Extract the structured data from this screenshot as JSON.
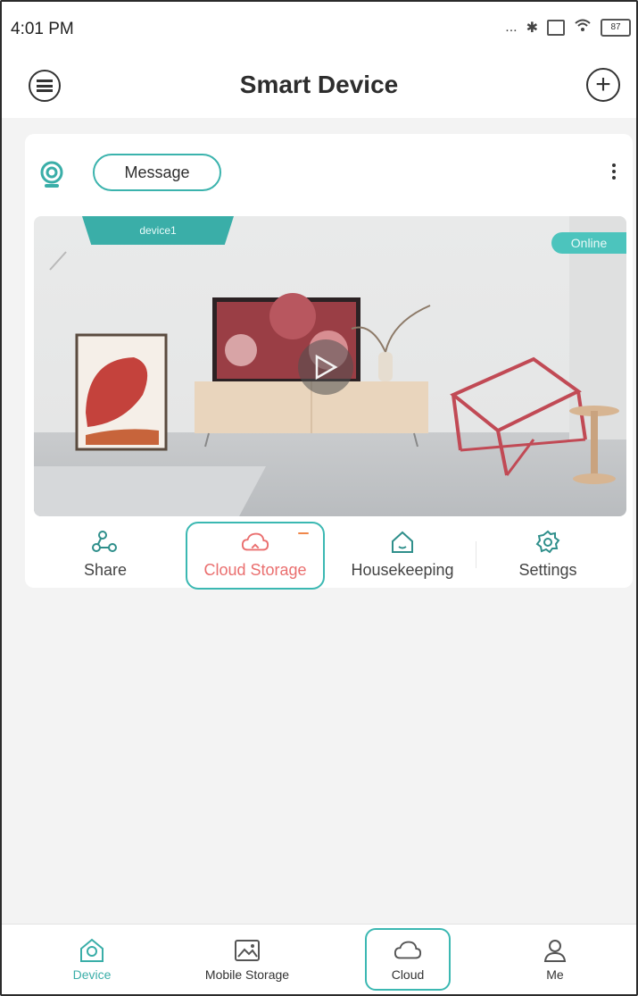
{
  "status_bar": {
    "time": "4:01 PM",
    "signal_dots": "...",
    "battery_level": "87"
  },
  "header": {
    "title": "Smart Device"
  },
  "device_card": {
    "message_label": "Message",
    "device_name": "device1",
    "status_badge": "Online",
    "actions": [
      {
        "label": "Share"
      },
      {
        "label": "Cloud Storage",
        "badge": ""
      },
      {
        "label": "Housekeeping"
      },
      {
        "label": "Settings"
      }
    ]
  },
  "bottom_nav": {
    "items": [
      {
        "label": "Device",
        "active": true
      },
      {
        "label": "Mobile Storage",
        "active": false
      },
      {
        "label": "Cloud",
        "active": false
      },
      {
        "label": "Me",
        "active": false
      }
    ]
  },
  "colors": {
    "accent": "#3aaea8",
    "accent_light": "#4cc4bd",
    "cloud_label": "#ea6f6f",
    "badge": "#f0874a"
  }
}
